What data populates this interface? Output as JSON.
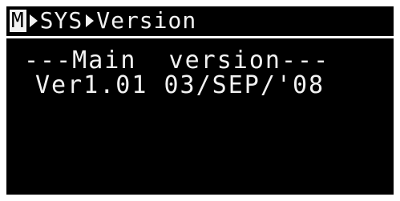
{
  "breadcrumb": {
    "root_label": "M",
    "segment1": "SYS",
    "segment2": "Version"
  },
  "content": {
    "heading": "---Main  version---",
    "version_line": "Ver1.01 03/SEP/'08"
  },
  "colors": {
    "screen_background": "#000000",
    "text": "#f2f2f2",
    "bezel": "#ffffff"
  },
  "icons": {
    "separator": "triangle-right-icon"
  }
}
